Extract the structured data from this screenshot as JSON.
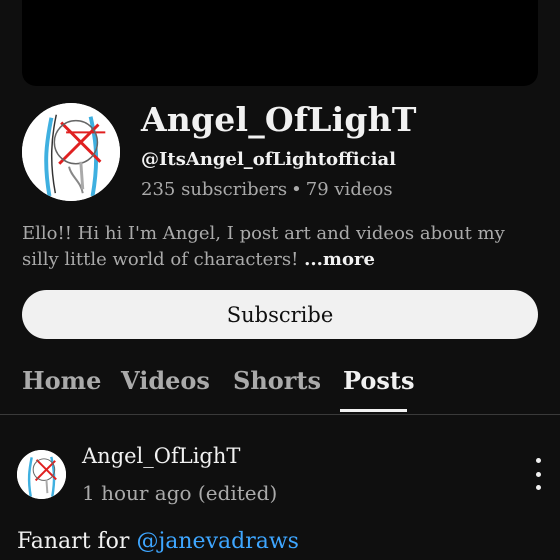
{
  "channel": {
    "name": "Angel_OfLighT",
    "handle": "@ItsAngel_ofLightofficial",
    "subscribers": "235 subscribers",
    "separator": "•",
    "videos": "79 videos",
    "description": "Ello!! Hi hi I'm Angel, I post art and videos about my silly little world of characters!",
    "more_label": "...more",
    "subscribe_label": "Subscribe"
  },
  "tabs": [
    {
      "label": "Home",
      "active": false
    },
    {
      "label": "Videos",
      "active": false
    },
    {
      "label": "Shorts",
      "active": false
    },
    {
      "label": "Posts",
      "active": true
    }
  ],
  "post": {
    "author": "Angel_OfLighT",
    "time": "1 hour ago (edited)",
    "text_prefix": "Fanart for",
    "mention": "@janevadraws"
  },
  "icons": {
    "avatar": "channel-avatar-sketch",
    "menu": "more-vertical-icon"
  },
  "colors": {
    "background": "#0f0f0f",
    "accent_link": "#3ea6ff",
    "subscribe_bg": "#f1f1f1"
  }
}
